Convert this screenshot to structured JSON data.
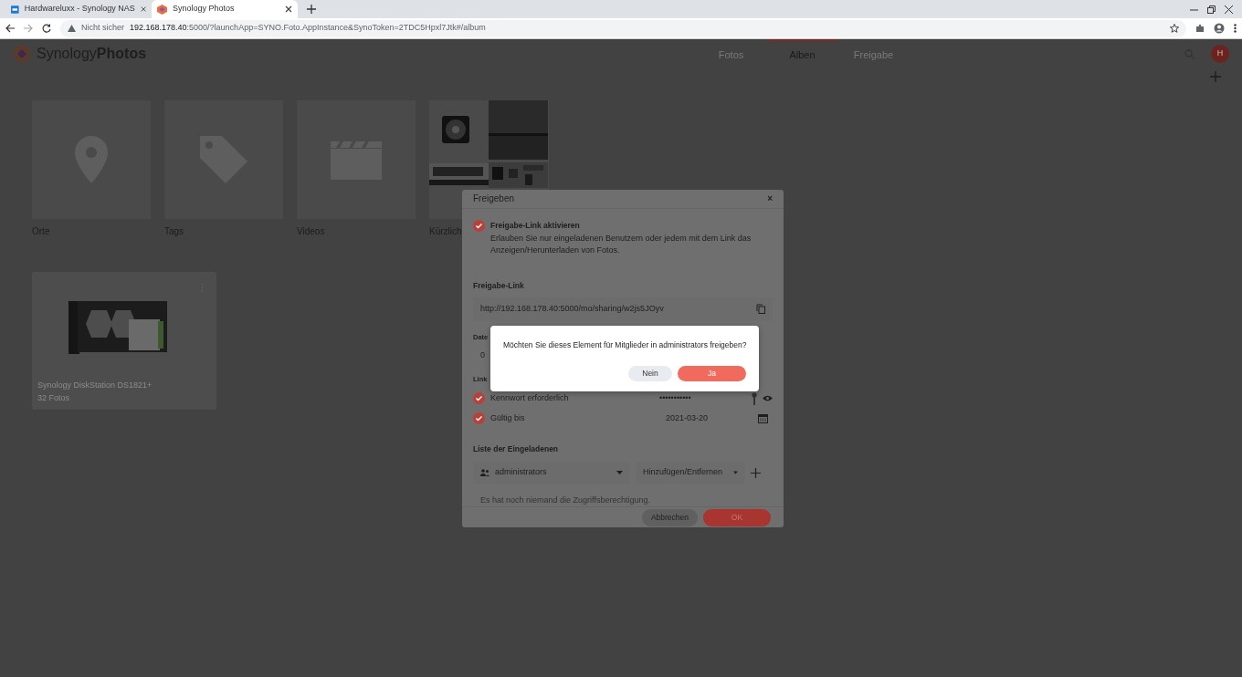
{
  "browser": {
    "tabs": [
      {
        "title": "Hardwareluxx - Synology NAS",
        "kind": "dsm",
        "selected": false
      },
      {
        "title": "Synology Photos",
        "kind": "photos",
        "selected": true
      }
    ],
    "security": "Nicht sicher",
    "url_host": "192.168.178.40",
    "url_rest": ":5000/?launchApp=SYNO.Foto.AppInstance&SynoToken=2TDC5Hpxl7Jtk#/album"
  },
  "app": {
    "logo_light": "Synology",
    "logo_bold": "Photos",
    "nav": [
      {
        "label": "Fotos",
        "selected": false
      },
      {
        "label": "Alben",
        "selected": true
      },
      {
        "label": "Freigabe",
        "selected": false
      }
    ],
    "avatar": "H"
  },
  "albums": [
    {
      "kind": "places",
      "label": "Orte"
    },
    {
      "kind": "tags",
      "label": "Tags"
    },
    {
      "kind": "videos",
      "label": "Videos"
    },
    {
      "kind": "recent",
      "label": "Kürzlich"
    }
  ],
  "user_albums": [
    {
      "title": "Synology DiskStation DS1821+",
      "count": "32 Fotos"
    }
  ],
  "share_dialog": {
    "title": "Freigeben",
    "close": "×",
    "enable": {
      "checked": true,
      "label": "Freigabe-Link aktivieren",
      "description": "Erlauben Sie nur eingeladenen Benutzern oder jedem mit dem Link das Anzeigen/Herunterladen von Fotos."
    },
    "link_label": "Freigabe-Link",
    "link": "http://192.168.178.40:5000/mo/sharing/w2js5JOyv",
    "date_label": "Date",
    "date_value": "0",
    "settings_label": "Link",
    "options": [
      {
        "kind": "password",
        "label": "Kennwort erforderlich",
        "checked": true,
        "value": "•••••••••••"
      },
      {
        "kind": "date",
        "label": "Gültig bis",
        "checked": true,
        "value": "2021-03-20"
      }
    ],
    "invitees_label": "Liste der Eingeladenen",
    "invitee": "administrators",
    "permission": "Hinzufügen/Entfernen",
    "empty_note": "Es hat noch niemand die Zugriffsberechtigung.",
    "cancel": "Abbrechen",
    "ok": "OK"
  },
  "confirm": {
    "message": "Möchten Sie dieses Element für Mitglieder in administrators freigeben?",
    "no": "Nein",
    "yes": "Ja"
  }
}
